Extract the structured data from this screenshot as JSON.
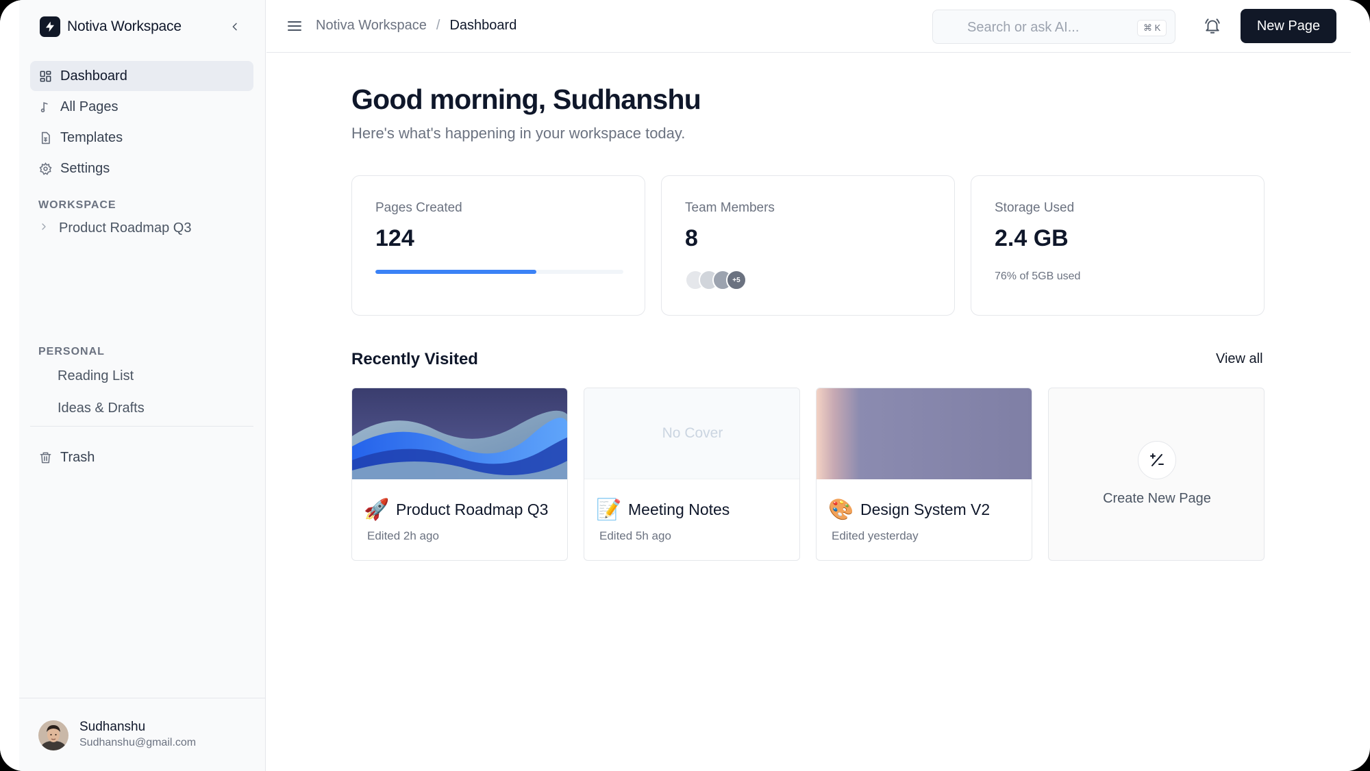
{
  "app": {
    "name": "Notiva Workspace"
  },
  "sidebar": {
    "nav": [
      {
        "label": "Dashboard",
        "icon": "dashboard-icon",
        "active": true
      },
      {
        "label": "All Pages",
        "icon": "pages-icon"
      },
      {
        "label": "Templates",
        "icon": "template-icon"
      },
      {
        "label": "Settings",
        "icon": "gear-icon"
      }
    ],
    "workspace_label": "WORKSPACE",
    "workspace_items": [
      {
        "label": "Product Roadmap Q3",
        "icon": "chevron-right-icon"
      }
    ],
    "personal_label": "PERSONAL",
    "personal_items": [
      {
        "label": "Reading List"
      },
      {
        "label": "Ideas & Drafts"
      }
    ],
    "trash_label": "Trash",
    "user": {
      "name": "Sudhanshu",
      "email": "Sudhanshu@gmail.com"
    }
  },
  "topbar": {
    "breadcrumb": [
      "Notiva Workspace",
      "Dashboard"
    ],
    "search_placeholder": "Search or ask AI...",
    "shortcut": "⌘ K",
    "new_page_label": "New Page"
  },
  "main": {
    "greeting": "Good morning, Sudhanshu",
    "subtitle": "Here's what's happening in your workspace today.",
    "stats": [
      {
        "label": "Pages Created",
        "value": "124",
        "progress_percent": 65
      },
      {
        "label": "Team Members",
        "value": "8",
        "avatars_extra": "+5"
      },
      {
        "label": "Storage Used",
        "value": "2.4 GB",
        "note": "76% of 5GB used"
      }
    ],
    "recent_title": "Recently Visited",
    "view_all_label": "View all",
    "recent": [
      {
        "title": "Product Roadmap Q3",
        "emoji": "🚀",
        "meta": "Edited 2h ago",
        "cover": "waves"
      },
      {
        "title": "Meeting Notes",
        "emoji": "📝",
        "meta": "Edited 5h ago",
        "cover": "none",
        "cover_text": "No Cover"
      },
      {
        "title": "Design System V2",
        "emoji": "🎨",
        "meta": "Edited yesterday",
        "cover": "gradient"
      }
    ],
    "create_label": "Create New Page"
  },
  "colors": {
    "accent": "#3b82f6",
    "primary_button": "#111827",
    "active_nav": "#e9ecf2"
  }
}
